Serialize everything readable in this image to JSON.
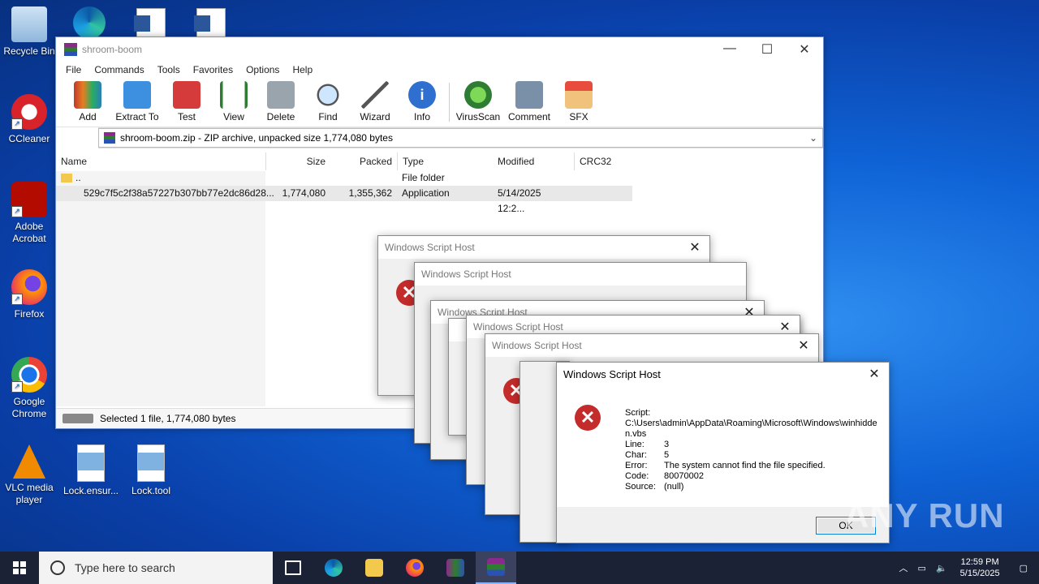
{
  "desktop": {
    "icons": [
      {
        "label": "Recycle Bin"
      },
      {
        "label": "CCleaner"
      },
      {
        "label": "Adobe Acrobat"
      },
      {
        "label": "Firefox"
      },
      {
        "label": "Google Chrome"
      },
      {
        "label": "VLC media player"
      },
      {
        "label": "Lock.ensur..."
      },
      {
        "label": "Lock.tool"
      }
    ]
  },
  "winrar": {
    "title": "shroom-boom",
    "menu": [
      "File",
      "Commands",
      "Tools",
      "Favorites",
      "Options",
      "Help"
    ],
    "toolbar": [
      "Add",
      "Extract To",
      "Test",
      "View",
      "Delete",
      "Find",
      "Wizard",
      "Info",
      "VirusScan",
      "Comment",
      "SFX"
    ],
    "address": "shroom-boom.zip - ZIP archive, unpacked size 1,774,080 bytes",
    "columns": {
      "name": "Name",
      "size": "Size",
      "packed": "Packed",
      "type": "Type",
      "modified": "Modified",
      "crc": "CRC32"
    },
    "rows": [
      {
        "name": "..",
        "size": "",
        "packed": "",
        "type": "File folder",
        "modified": "",
        "crc": ""
      },
      {
        "name": "529c7f5c2f38a57227b307bb77e2dc86d28...",
        "size": "1,774,080",
        "packed": "1,355,362",
        "type": "Application",
        "modified": "5/14/2025 12:2...",
        "crc": ""
      }
    ],
    "status": "Selected 1 file, 1,774,080 bytes"
  },
  "dialogs": {
    "title": "Windows Script Host",
    "close": "✕",
    "script_label": "Script:",
    "script_path": "C:\\Users\\admin\\AppData\\Roaming\\Microsoft\\Windows\\winhidden.vbs",
    "line_label": "Line:",
    "line": "3",
    "char_label": "Char:",
    "char": "5",
    "error_label": "Error:",
    "error": "The system cannot find the file specified.",
    "code_label": "Code:",
    "code": "80070002",
    "source_label": "Source:",
    "source": "(null)",
    "ok": "OK"
  },
  "taskbar": {
    "search_placeholder": "Type here to search",
    "time": "12:59 PM",
    "date": "5/15/2025"
  },
  "watermark": "ANY RUN"
}
